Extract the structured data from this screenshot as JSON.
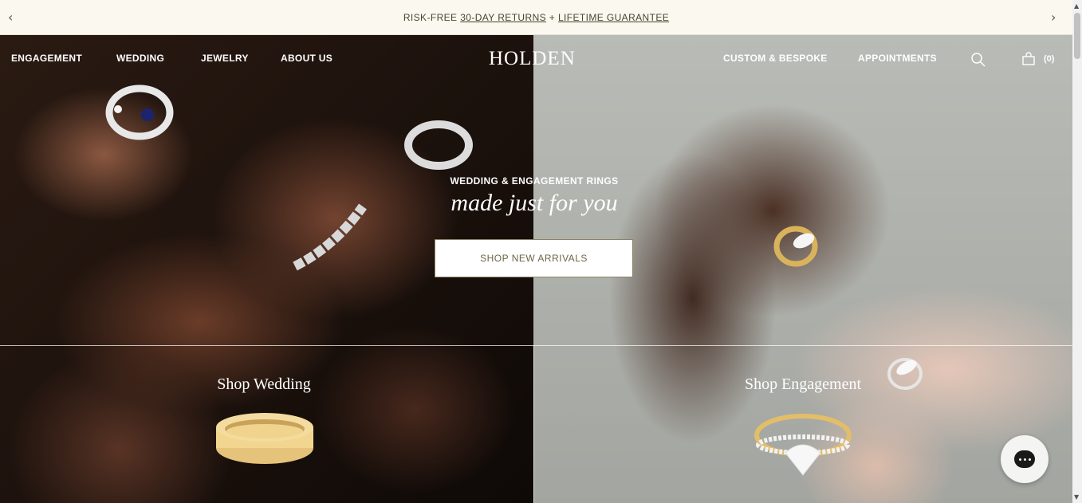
{
  "announcement": {
    "prefix": "RISK-FREE",
    "returns_link": "30-DAY RETURNS",
    "plus": "+",
    "guarantee_link": "LIFETIME GUARANTEE",
    "prev_icon": "chevron-left-icon",
    "next_icon": "chevron-right-icon"
  },
  "nav": {
    "left_items": [
      "ENGAGEMENT",
      "WEDDING",
      "JEWELRY",
      "ABOUT US"
    ],
    "logo": "HOLDEN",
    "right_items": [
      "CUSTOM & BESPOKE",
      "APPOINTMENTS"
    ],
    "search_icon": "search-icon",
    "cart_icon": "shopping-bag-icon",
    "cart_count": "(0)"
  },
  "hero": {
    "eyebrow": "WEDDING & ENGAGEMENT RINGS",
    "tagline": "made just for you",
    "cta_label": "SHOP NEW ARRIVALS"
  },
  "sections": {
    "wedding_title": "Shop Wedding",
    "engagement_title": "Shop Engagement"
  },
  "chat": {
    "icon": "chat-bubble-icon"
  },
  "colors": {
    "announcement_bg": "#faf8ef",
    "cta_text": "#6b6545",
    "text_on_photo": "#ffffff",
    "gold": "#e8c97a"
  }
}
